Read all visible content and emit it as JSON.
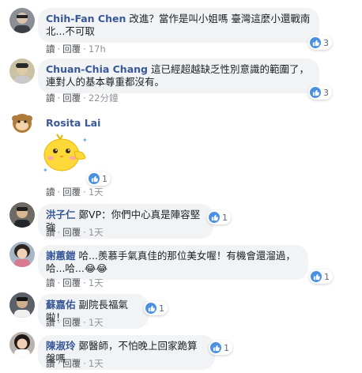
{
  "colors": {
    "author": "#385898",
    "bubble_bg": "#f2f3f5",
    "like_blue": "#4a90e2",
    "meta_gray": "#90949c"
  },
  "actions": {
    "translate": "讀",
    "reply": "回覆",
    "separator": "·"
  },
  "comments": [
    {
      "author": "Chih-Fan Chen",
      "text": "改進？當作是叫小姐嗎 臺灣這麼小還戰南北...不可取",
      "time": "17h",
      "likes": "3",
      "avatar_icon": "user-photo-icon"
    },
    {
      "author": "Chuan-Chia Chang",
      "text": "這已經超越缺乏性別意識的範圍了，連對人的基本尊重都沒有。",
      "time": "22分鐘",
      "likes": "3",
      "avatar_icon": "user-photo-icon"
    },
    {
      "author": "Rosita Lai",
      "text": "",
      "time": "1天",
      "likes": "1",
      "sticker": "yellow-chick-sticker",
      "avatar_icon": "user-photo-icon"
    },
    {
      "author": "洪子仁",
      "text": "鄭VP：你們中心真是陣容堅強",
      "time": "1天",
      "likes": "1",
      "avatar_icon": "user-photo-icon"
    },
    {
      "author": "謝蕙鎧",
      "text": "哈...羨慕手氣真佳的那位美女喔！有機會還溜過，哈...哈...😂😂",
      "time": "1天",
      "likes": "1",
      "avatar_icon": "user-photo-icon"
    },
    {
      "author": "蘇嘉佑",
      "text": "副院長福氣啦！",
      "time": "1天",
      "likes": "1",
      "avatar_icon": "user-photo-icon"
    },
    {
      "author": "陳淑玲",
      "text": "鄭醫師，不怕晚上回家跪算盤嗎",
      "time": "1天",
      "likes": "1",
      "avatar_icon": "user-photo-icon"
    }
  ]
}
